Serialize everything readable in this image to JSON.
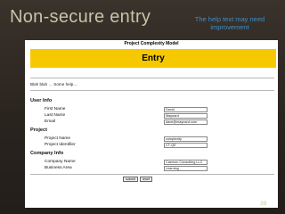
{
  "slide": {
    "title": "Non-secure entry",
    "note": "The help text may need improvement",
    "page_number": "39"
  },
  "form": {
    "model_title": "Project Complexity Model",
    "heading": "Entry",
    "intro": "Blah blah … Some help…",
    "sections": {
      "user_info": {
        "title": "User Info",
        "fields": [
          {
            "label": "First Name",
            "value": "David"
          },
          {
            "label": "Last Name",
            "value": "Maynard"
          },
          {
            "label": "Email",
            "value": "dave@maynard.com"
          }
        ]
      },
      "project": {
        "title": "Project",
        "fields": [
          {
            "label": "Project Name",
            "value": "complexity"
          },
          {
            "label": "Project Identifier",
            "value": "CT-QE"
          }
        ]
      },
      "company_info": {
        "title": "Company Info",
        "fields": [
          {
            "label": "Company Name",
            "value": "Caemon Consulting LLC"
          },
          {
            "label": "Business Area",
            "value": "Learning"
          }
        ]
      }
    },
    "buttons": {
      "submit": "submit",
      "reset": "reset"
    }
  },
  "colors": {
    "banner": "#f6c800",
    "title_text": "#c9c2a8",
    "note_text": "#3a8fc9"
  }
}
